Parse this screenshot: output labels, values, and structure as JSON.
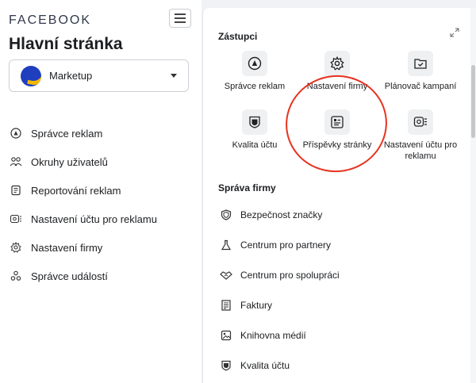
{
  "sidebar": {
    "brand": "FACEBOOK",
    "title": "Hlavní stránka",
    "account": {
      "name": "Marketup"
    },
    "items": [
      {
        "label": "Správce reklam",
        "icon": "ads-manager-icon"
      },
      {
        "label": "Okruhy uživatelů",
        "icon": "audiences-icon"
      },
      {
        "label": "Reportování reklam",
        "icon": "ads-reporting-icon"
      },
      {
        "label": "Nastavení účtu pro reklamu",
        "icon": "ad-account-settings-icon"
      },
      {
        "label": "Nastavení firmy",
        "icon": "gear-icon"
      },
      {
        "label": "Správce událostí",
        "icon": "events-manager-icon"
      }
    ]
  },
  "panel": {
    "shortcuts_title": "Zástupci",
    "shortcuts": [
      {
        "label": "Správce reklam",
        "icon": "ads-manager-icon"
      },
      {
        "label": "Nastavení firmy",
        "icon": "gear-icon"
      },
      {
        "label": "Plánovač kampaní",
        "icon": "campaign-planner-icon"
      },
      {
        "label": "Kvalita účtu",
        "icon": "account-quality-icon"
      },
      {
        "label": "Příspěvky stránky",
        "icon": "page-posts-icon"
      },
      {
        "label": "Nastavení účtu pro reklamu",
        "icon": "ad-account-settings-icon"
      }
    ],
    "business_title": "Správa firmy",
    "business_items": [
      {
        "label": "Bezpečnost značky",
        "icon": "shield-icon"
      },
      {
        "label": "Centrum pro partnery",
        "icon": "flask-icon"
      },
      {
        "label": "Centrum pro spolupráci",
        "icon": "handshake-icon"
      },
      {
        "label": "Faktury",
        "icon": "invoice-icon"
      },
      {
        "label": "Knihovna médií",
        "icon": "media-library-icon"
      },
      {
        "label": "Kvalita účtu",
        "icon": "account-quality-icon"
      }
    ]
  },
  "colors": {
    "annotation_circle": "#e8321f",
    "account_avatar": "#1f3fbf",
    "account_avatar_accent": "#f5b800"
  }
}
